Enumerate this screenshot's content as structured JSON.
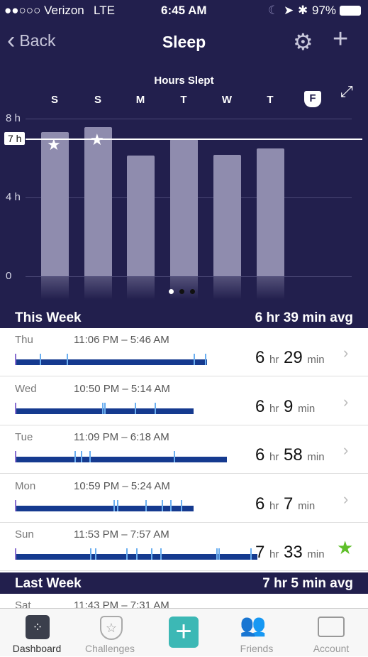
{
  "status": {
    "carrier": "●●○○○ Verizon",
    "network": "LTE",
    "time": "6:45 AM",
    "battery": "97%"
  },
  "nav": {
    "back": "Back",
    "title": "Sleep"
  },
  "chart_data": {
    "type": "bar",
    "title": "Hours Slept",
    "categories": [
      "S",
      "S",
      "M",
      "T",
      "W",
      "T",
      "F"
    ],
    "values": [
      7.3,
      7.55,
      6.12,
      6.97,
      6.15,
      6.48,
      null
    ],
    "goal": 7,
    "goal_label": "7 h",
    "yticks": [
      "8 h",
      "4 h",
      "0"
    ],
    "ylim": [
      0,
      8
    ],
    "starred": [
      true,
      true,
      false,
      false,
      false,
      false,
      false
    ],
    "selected": "F",
    "bar_color": "#8f8cae"
  },
  "this_week": {
    "label": "This Week",
    "avg": "6 hr 39 min avg"
  },
  "last_week": {
    "label": "Last Week",
    "avg": "7 hr 5 min avg"
  },
  "entries": [
    {
      "day": "Thu",
      "time": "11:06 PM – 5:46 AM",
      "hr": "6",
      "min": "29",
      "fill": 0.57,
      "marks": [
        0.13,
        0.27,
        0.93,
        0.99
      ],
      "star": false
    },
    {
      "day": "Wed",
      "time": "10:50 PM – 5:14 AM",
      "hr": "6",
      "min": "9",
      "fill": 0.53,
      "marks": [
        0.49,
        0.5,
        0.67,
        0.78
      ],
      "star": false
    },
    {
      "day": "Tue",
      "time": "11:09 PM – 6:18 AM",
      "hr": "6",
      "min": "58",
      "fill": 0.63,
      "marks": [
        0.28,
        0.31,
        0.35,
        0.75
      ],
      "star": false
    },
    {
      "day": "Mon",
      "time": "10:59 PM – 5:24 AM",
      "hr": "6",
      "min": "7",
      "fill": 0.53,
      "marks": [
        0.55,
        0.57,
        0.73,
        0.82,
        0.87,
        0.93
      ],
      "star": false
    },
    {
      "day": "Sun",
      "time": "11:53 PM – 7:57 AM",
      "hr": "7",
      "min": "33",
      "fill": 0.72,
      "marks": [
        0.31,
        0.33,
        0.46,
        0.5,
        0.56,
        0.6,
        0.83,
        0.84,
        0.97
      ],
      "star": true
    }
  ],
  "partial": {
    "day": "Sat",
    "time": "11:43 PM – 7:31 AM"
  },
  "units": {
    "hr": "hr",
    "min": "min"
  },
  "tabs": [
    "Dashboard",
    "Challenges",
    "",
    "Friends",
    "Account"
  ]
}
